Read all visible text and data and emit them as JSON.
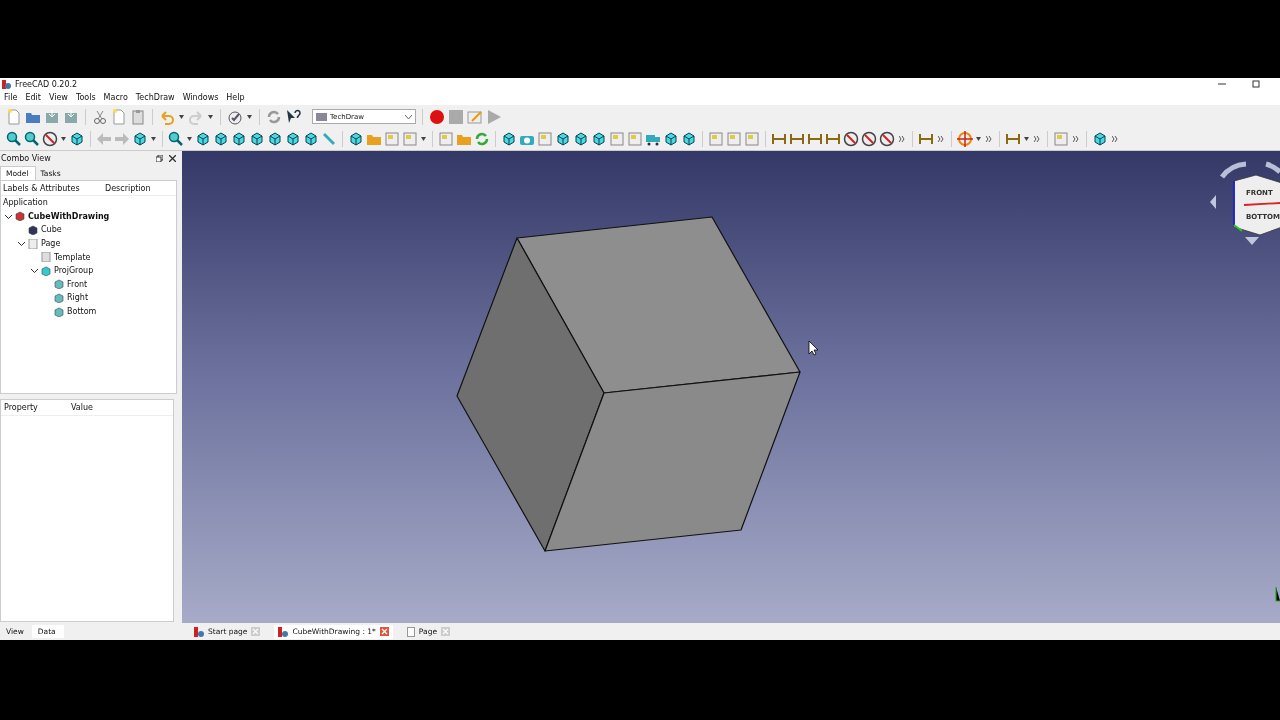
{
  "window": {
    "title": "FreeCAD 0.20.2"
  },
  "menu": [
    "File",
    "Edit",
    "View",
    "Tools",
    "Macro",
    "TechDraw",
    "Windows",
    "Help"
  ],
  "workbench": {
    "value": "TechDraw"
  },
  "combo_view": {
    "title": "Combo View",
    "tabs": [
      {
        "label": "Model",
        "selected": true
      },
      {
        "label": "Tasks",
        "selected": false
      }
    ],
    "columns": [
      "Labels & Attributes",
      "Description"
    ],
    "root_label": "Application",
    "tree": [
      {
        "label": "CubeWithDrawing",
        "kind": "document",
        "expanded": true,
        "children": [
          {
            "label": "Cube",
            "kind": "cube"
          },
          {
            "label": "Page",
            "kind": "page",
            "expanded": true,
            "children": [
              {
                "label": "Template",
                "kind": "template"
              },
              {
                "label": "ProjGroup",
                "kind": "group",
                "expanded": true,
                "children": [
                  {
                    "label": "Front",
                    "kind": "view"
                  },
                  {
                    "label": "Right",
                    "kind": "view"
                  },
                  {
                    "label": "Bottom",
                    "kind": "view"
                  }
                ]
              }
            ]
          }
        ]
      }
    ]
  },
  "property_view": {
    "columns": [
      "Property",
      "Value"
    ],
    "tabs": [
      {
        "label": "View",
        "selected": false
      },
      {
        "label": "Data",
        "selected": true
      }
    ]
  },
  "navigation_cube": {
    "faces": [
      "FRONT",
      "BOTTOM"
    ]
  },
  "document_tabs": [
    {
      "label": "Start page",
      "kind": "start",
      "selected": false
    },
    {
      "label": "CubeWithDrawing : 1*",
      "kind": "start",
      "selected": true
    },
    {
      "label": "Page",
      "kind": "page",
      "selected": false
    }
  ]
}
